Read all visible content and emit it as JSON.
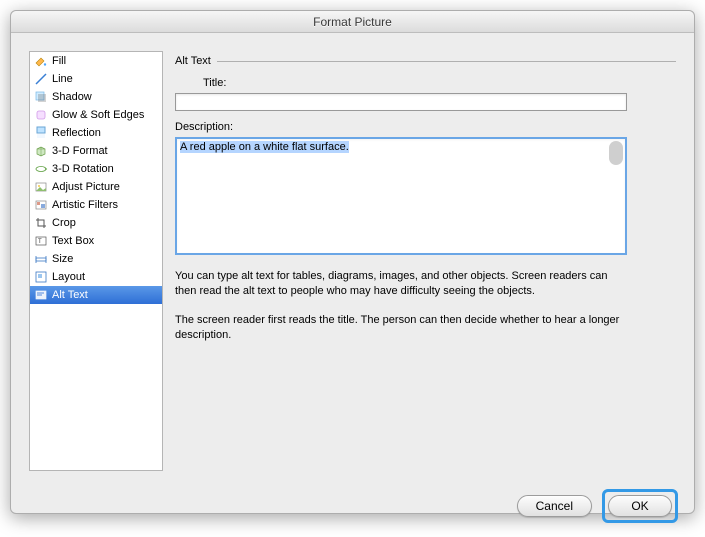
{
  "dialog": {
    "title": "Format Picture"
  },
  "sidebar": {
    "items": [
      {
        "label": "Fill"
      },
      {
        "label": "Line"
      },
      {
        "label": "Shadow"
      },
      {
        "label": "Glow & Soft Edges"
      },
      {
        "label": "Reflection"
      },
      {
        "label": "3-D Format"
      },
      {
        "label": "3-D Rotation"
      },
      {
        "label": "Adjust Picture"
      },
      {
        "label": "Artistic Filters"
      },
      {
        "label": "Crop"
      },
      {
        "label": "Text Box"
      },
      {
        "label": "Size"
      },
      {
        "label": "Layout"
      },
      {
        "label": "Alt Text"
      }
    ],
    "selected_index": 13
  },
  "panel": {
    "legend": "Alt Text",
    "title_label": "Title:",
    "title_value": "",
    "description_label": "Description:",
    "description_value": "A red apple on a white flat surface.",
    "help_1": "You can type alt text for tables, diagrams, images, and other objects. Screen readers can then read the alt text to people who may have difficulty seeing the objects.",
    "help_2": "The screen reader first reads the title. The person can then decide whether to hear a longer description."
  },
  "buttons": {
    "cancel": "Cancel",
    "ok": "OK"
  }
}
